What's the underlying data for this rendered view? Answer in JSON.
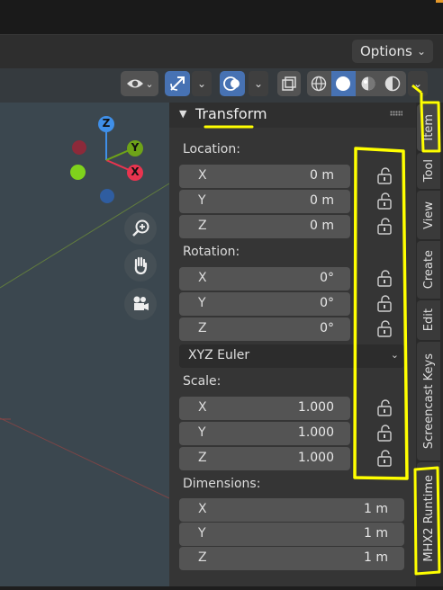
{
  "header": {
    "options_label": "Options"
  },
  "gizmo": {
    "z": "Z",
    "y": "Y",
    "x": "X"
  },
  "panel": {
    "title": "Transform",
    "location": {
      "label": "Location:",
      "rows": [
        {
          "axis": "X",
          "value": "0 m"
        },
        {
          "axis": "Y",
          "value": "0 m"
        },
        {
          "axis": "Z",
          "value": "0 m"
        }
      ]
    },
    "rotation": {
      "label": "Rotation:",
      "rows": [
        {
          "axis": "X",
          "value": "0°"
        },
        {
          "axis": "Y",
          "value": "0°"
        },
        {
          "axis": "Z",
          "value": "0°"
        }
      ],
      "mode": "XYZ Euler"
    },
    "scale": {
      "label": "Scale:",
      "rows": [
        {
          "axis": "X",
          "value": "1.000"
        },
        {
          "axis": "Y",
          "value": "1.000"
        },
        {
          "axis": "Z",
          "value": "1.000"
        }
      ]
    },
    "dimensions": {
      "label": "Dimensions:",
      "rows": [
        {
          "axis": "X",
          "value": "1 m"
        },
        {
          "axis": "Y",
          "value": "1 m"
        },
        {
          "axis": "Z",
          "value": "1 m"
        }
      ]
    }
  },
  "tabs": [
    "Item",
    "Tool",
    "View",
    "Create",
    "Edit",
    "Screencast Keys",
    "MHX2 Runtime"
  ],
  "colors": {
    "accent": "#4772b3",
    "annotation": "#ffff00",
    "gizmo_x": "#e8344f",
    "gizmo_y": "#6ea318",
    "gizmo_z": "#3f8fe8"
  }
}
